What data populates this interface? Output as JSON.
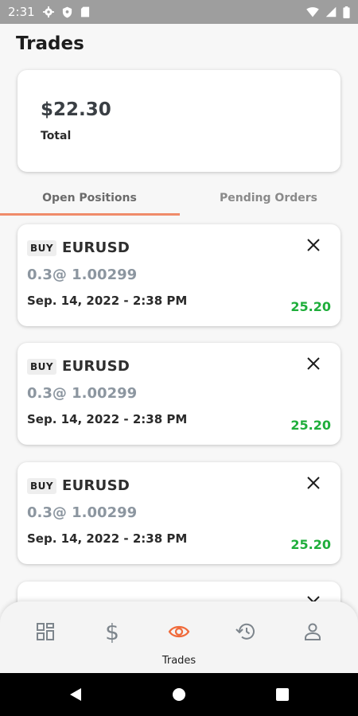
{
  "status_bar": {
    "time": "2:31"
  },
  "header": {
    "title": "Trades"
  },
  "summary": {
    "amount": "$22.30",
    "label": "Total"
  },
  "tabs": [
    {
      "label": "Open Positions",
      "active": true
    },
    {
      "label": "Pending Orders",
      "active": false
    }
  ],
  "positions": [
    {
      "side": "BUY",
      "symbol": "EURUSD",
      "qty_price": "0.3@ 1.00299",
      "time": "Sep. 14, 2022 - 2:38 PM",
      "pnl": "25.20"
    },
    {
      "side": "BUY",
      "symbol": "EURUSD",
      "qty_price": "0.3@ 1.00299",
      "time": "Sep. 14, 2022 - 2:38 PM",
      "pnl": "25.20"
    },
    {
      "side": "BUY",
      "symbol": "EURUSD",
      "qty_price": "0.3@ 1.00299",
      "time": "Sep. 14, 2022 - 2:38 PM",
      "pnl": "25.20"
    }
  ],
  "bottom_nav": {
    "items": [
      {
        "icon": "dashboard-icon"
      },
      {
        "icon": "dollar-icon"
      },
      {
        "icon": "eye-icon",
        "active": true
      },
      {
        "icon": "history-icon"
      },
      {
        "icon": "profile-icon"
      }
    ],
    "active_label": "Trades",
    "active_color": "#f06a3a",
    "inactive_color": "#7d858c"
  },
  "colors": {
    "profit": "#1fae3b",
    "tab_indicator": "#f08b6a"
  }
}
